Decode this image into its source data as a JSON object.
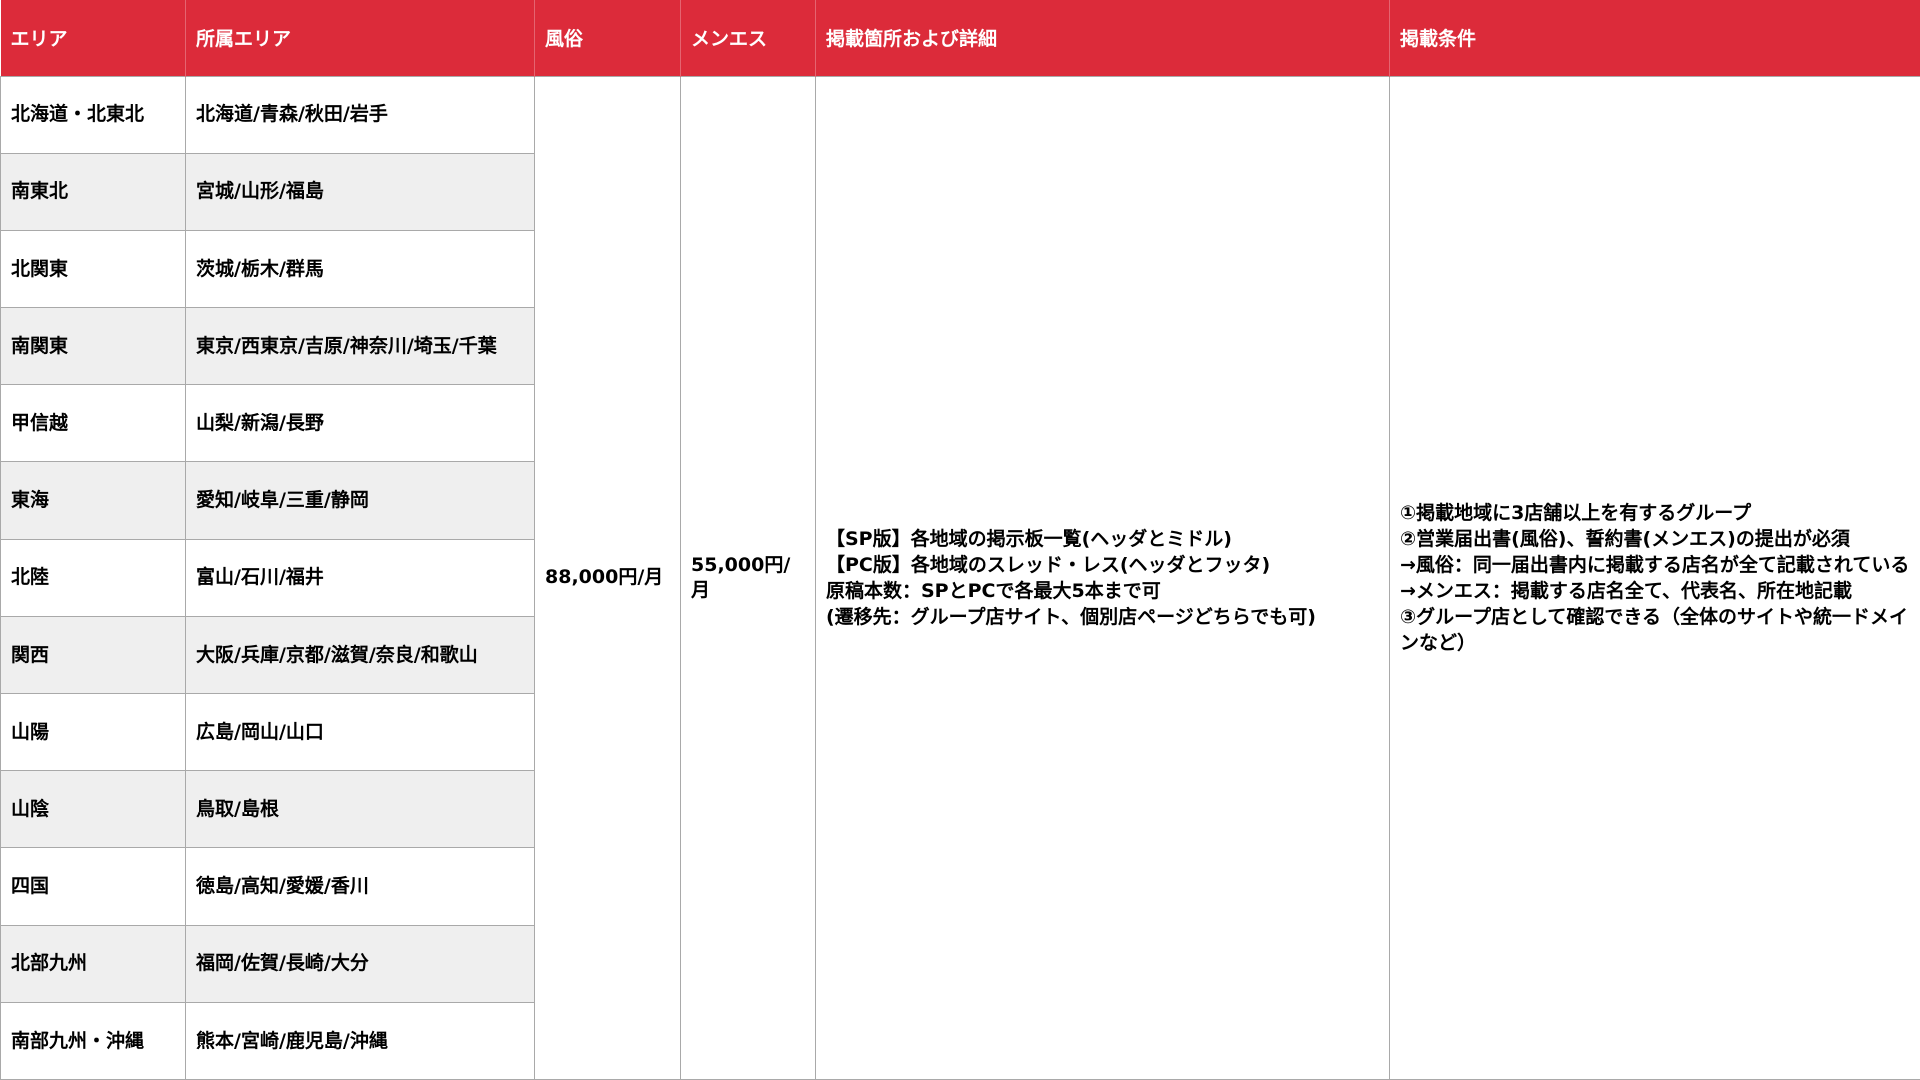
{
  "table": {
    "headers": {
      "area": "エリア",
      "sub_area": "所属エリア",
      "fuzoku": "風俗",
      "menes": "メンエス",
      "detail": "掲載箇所および詳細",
      "conditions": "掲載条件"
    },
    "rows": [
      {
        "area": "北海道・北東北",
        "sub_area": "北海道/青森/秋田/岩手"
      },
      {
        "area": "南東北",
        "sub_area": "宮城/山形/福島"
      },
      {
        "area": "北関東",
        "sub_area": "茨城/栃木/群馬"
      },
      {
        "area": "南関東",
        "sub_area": "東京/西東京/吉原/神奈川/埼玉/千葉"
      },
      {
        "area": "甲信越",
        "sub_area": "山梨/新潟/長野"
      },
      {
        "area": "東海",
        "sub_area": "愛知/岐阜/三重/静岡"
      },
      {
        "area": "北陸",
        "sub_area": "富山/石川/福井"
      },
      {
        "area": "関西",
        "sub_area": "大阪/兵庫/京都/滋賀/奈良/和歌山"
      },
      {
        "area": "山陽",
        "sub_area": "広島/岡山/山口"
      },
      {
        "area": "山陰",
        "sub_area": "鳥取/島根"
      },
      {
        "area": "四国",
        "sub_area": "徳島/高知/愛媛/香川"
      },
      {
        "area": "北部九州",
        "sub_area": "福岡/佐賀/長崎/大分"
      },
      {
        "area": "南部九州・沖縄",
        "sub_area": "熊本/宮崎/鹿児島/沖縄"
      }
    ],
    "price_fuzoku": "88,000円/月",
    "price_menes": "55,000円/月",
    "detail_lines": [
      "【SP版】各地域の掲示板一覧(ヘッダとミドル)",
      "【PC版】各地域のスレッド・レス(ヘッダとフッタ)",
      "原稿本数：SPとPCで各最大5本まで可",
      "(遷移先：グループ店サイト、個別店ページどちらでも可)"
    ],
    "condition_lines": [
      "①掲載地域に3店舗以上を有するグループ",
      "②営業届出書(風俗)、誓約書(メンエス)の提出が必須",
      "→風俗：同一届出書内に掲載する店名が全て記載されている",
      "→メンエス：掲載する店名全て、代表名、所在地記載",
      "③グループ店として確認できる（全体のサイトや統一ドメインなど）"
    ]
  }
}
